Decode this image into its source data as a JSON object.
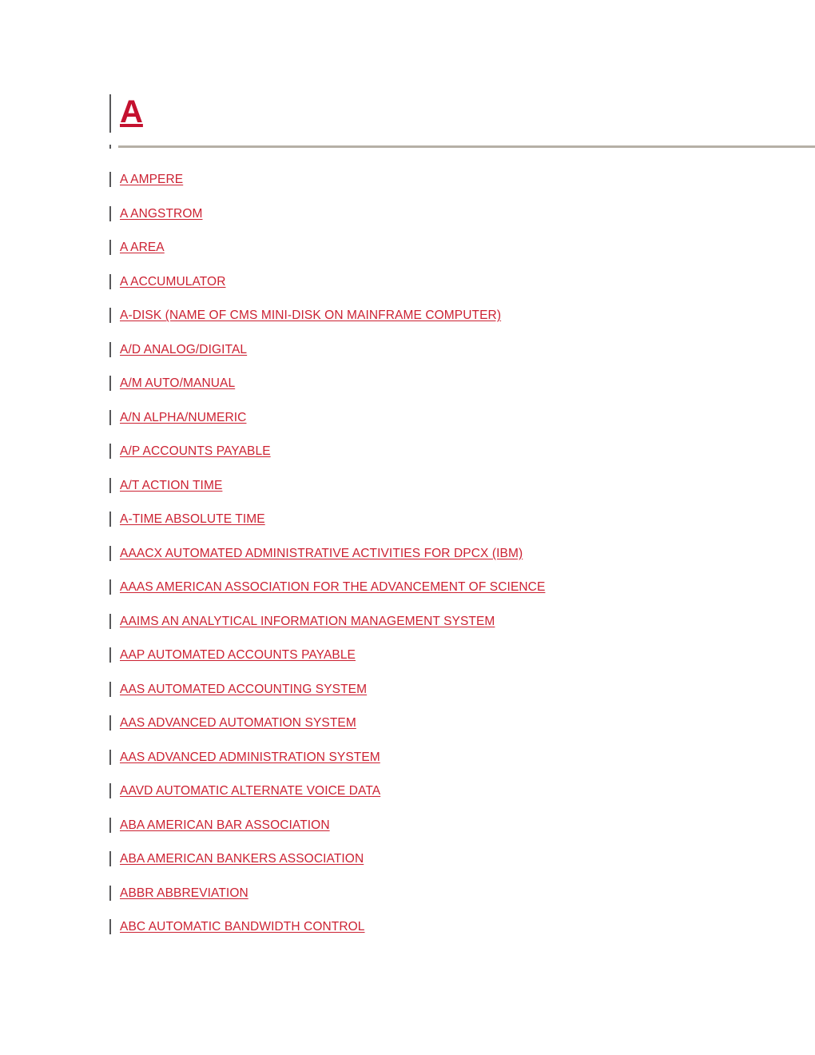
{
  "document": {
    "heading": {
      "letter": "A"
    },
    "colors": {
      "link": "#cc2233",
      "heading": "#c4112f",
      "change_bar": "#58585a",
      "rule": "#b5b0a6",
      "background": "#ffffff"
    },
    "entries": [
      {
        "label": "A AMPERE"
      },
      {
        "label": "A ANGSTROM"
      },
      {
        "label": "A AREA"
      },
      {
        "label": "A ACCUMULATOR"
      },
      {
        "label": "A-DISK (NAME OF CMS MINI-DISK ON MAINFRAME COMPUTER)"
      },
      {
        "label": "A/D ANALOG/DIGITAL"
      },
      {
        "label": "A/M AUTO/MANUAL"
      },
      {
        "label": "A/N ALPHA/NUMERIC"
      },
      {
        "label": "A/P ACCOUNTS PAYABLE"
      },
      {
        "label": "A/T ACTION TIME"
      },
      {
        "label": "A-TIME ABSOLUTE TIME"
      },
      {
        "label": "AAACX AUTOMATED ADMINISTRATIVE ACTIVITIES FOR DPCX (IBM)"
      },
      {
        "label": "AAAS AMERICAN ASSOCIATION FOR THE ADVANCEMENT OF SCIENCE"
      },
      {
        "label": "AAIMS AN ANALYTICAL INFORMATION MANAGEMENT SYSTEM"
      },
      {
        "label": "AAP AUTOMATED ACCOUNTS PAYABLE"
      },
      {
        "label": "AAS AUTOMATED ACCOUNTING SYSTEM"
      },
      {
        "label": "AAS ADVANCED AUTOMATION SYSTEM"
      },
      {
        "label": "AAS ADVANCED ADMINISTRATION SYSTEM"
      },
      {
        "label": "AAVD AUTOMATIC ALTERNATE VOICE DATA"
      },
      {
        "label": "ABA AMERICAN BAR ASSOCIATION"
      },
      {
        "label": "ABA AMERICAN BANKERS ASSOCIATION"
      },
      {
        "label": "ABBR ABBREVIATION"
      },
      {
        "label": "ABC AUTOMATIC BANDWIDTH CONTROL"
      }
    ]
  }
}
